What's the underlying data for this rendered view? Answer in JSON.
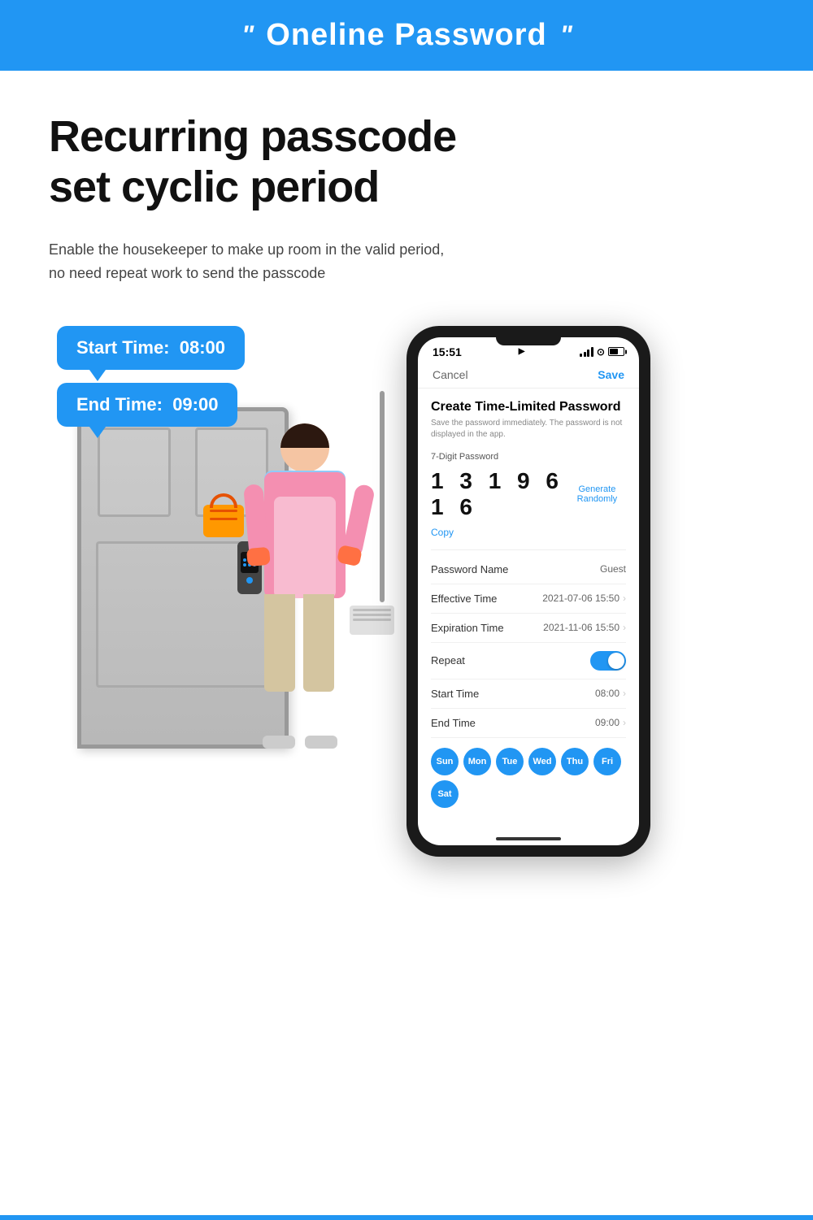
{
  "header": {
    "quote_left": "\"",
    "title": "Oneline Password",
    "quote_right": "\""
  },
  "hero": {
    "heading_line1": "Recurring passcode",
    "heading_line2": "set cyclic period",
    "description": "Enable the housekeeper to make up room in the valid period, no need repeat work to send the passcode"
  },
  "bubbles": {
    "start_time_label": "Start Time:",
    "start_time_value": "08:00",
    "end_time_label": "End Time:",
    "end_time_value": "09:00"
  },
  "phone": {
    "status_time": "15:51",
    "nav_cancel": "Cancel",
    "nav_save": "Save",
    "create_title": "Create Time-Limited Password",
    "create_subtitle": "Save the password immediately. The password is not displayed in the app.",
    "digit_label": "7-Digit Password",
    "passcode": "1 3 1 9 6 1 6",
    "generate_btn": "Generate Randomly",
    "copy_link": "Copy",
    "rows": [
      {
        "label": "Password Name",
        "value": "Guest"
      },
      {
        "label": "Effective Time",
        "value": "2021-07-06 15:50 ›"
      },
      {
        "label": "Expiration Time",
        "value": "2021-11-06 15:50 ›"
      },
      {
        "label": "Repeat",
        "value": "toggle"
      },
      {
        "label": "Start Time",
        "value": "08:00 ›"
      },
      {
        "label": "End Time",
        "value": "09:00 ›"
      }
    ],
    "days": [
      {
        "label": "Sun",
        "active": true
      },
      {
        "label": "Mon",
        "active": true
      },
      {
        "label": "Tue",
        "active": true
      },
      {
        "label": "Wed",
        "active": true
      },
      {
        "label": "Thu",
        "active": true
      },
      {
        "label": "Fri",
        "active": true
      },
      {
        "label": "Sat",
        "active": true
      }
    ]
  },
  "colors": {
    "accent": "#2196F3",
    "header_bg": "#2196F3"
  }
}
